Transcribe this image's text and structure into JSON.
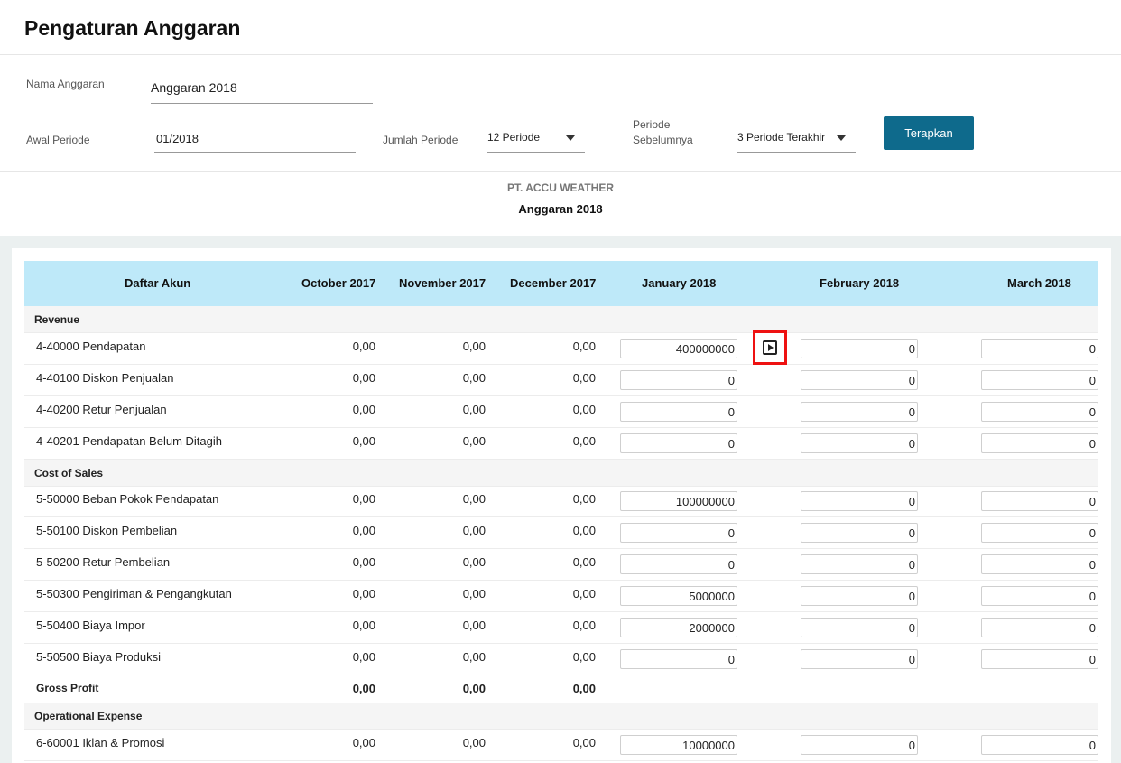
{
  "header": {
    "title": "Pengaturan Anggaran"
  },
  "form": {
    "name_label": "Nama Anggaran",
    "name_value": "Anggaran 2018",
    "start_label": "Awal Periode",
    "start_value": "01/2018",
    "count_label": "Jumlah Periode",
    "count_value": "12 Periode",
    "prev_label_line1": "Periode",
    "prev_label_line2": "Sebelumnya",
    "prev_value": "3 Periode Terakhir",
    "apply_label": "Terapkan"
  },
  "report": {
    "company": "PT. ACCU WEATHER",
    "title": "Anggaran 2018"
  },
  "table": {
    "headers": [
      "Daftar Akun",
      "October 2017",
      "November 2017",
      "December 2017",
      "January 2018",
      "February 2018",
      "March 2018"
    ],
    "sections": [
      {
        "label": "Revenue"
      },
      {
        "label": "Cost of Sales"
      },
      {
        "label": "Operational Expense"
      }
    ],
    "rows": [
      {
        "account": "4-40000 Pendapatan",
        "oct": "0,00",
        "nov": "0,00",
        "dec": "0,00",
        "jan": "400000000",
        "feb": "0",
        "mar": "0"
      },
      {
        "account": "4-40100 Diskon Penjualan",
        "oct": "0,00",
        "nov": "0,00",
        "dec": "0,00",
        "jan": "0",
        "feb": "0",
        "mar": "0"
      },
      {
        "account": "4-40200 Retur Penjualan",
        "oct": "0,00",
        "nov": "0,00",
        "dec": "0,00",
        "jan": "0",
        "feb": "0",
        "mar": "0"
      },
      {
        "account": "4-40201 Pendapatan Belum Ditagih",
        "oct": "0,00",
        "nov": "0,00",
        "dec": "0,00",
        "jan": "0",
        "feb": "0",
        "mar": "0"
      },
      {
        "account": "5-50000 Beban Pokok Pendapatan",
        "oct": "0,00",
        "nov": "0,00",
        "dec": "0,00",
        "jan": "100000000",
        "feb": "0",
        "mar": "0"
      },
      {
        "account": "5-50100 Diskon Pembelian",
        "oct": "0,00",
        "nov": "0,00",
        "dec": "0,00",
        "jan": "0",
        "feb": "0",
        "mar": "0"
      },
      {
        "account": "5-50200 Retur Pembelian",
        "oct": "0,00",
        "nov": "0,00",
        "dec": "0,00",
        "jan": "0",
        "feb": "0",
        "mar": "0"
      },
      {
        "account": "5-50300 Pengiriman & Pengangkutan",
        "oct": "0,00",
        "nov": "0,00",
        "dec": "0,00",
        "jan": "5000000",
        "feb": "0",
        "mar": "0"
      },
      {
        "account": "5-50400 Biaya Impor",
        "oct": "0,00",
        "nov": "0,00",
        "dec": "0,00",
        "jan": "2000000",
        "feb": "0",
        "mar": "0"
      },
      {
        "account": "5-50500 Biaya Produksi",
        "oct": "0,00",
        "nov": "0,00",
        "dec": "0,00",
        "jan": "0",
        "feb": "0",
        "mar": "0"
      },
      {
        "account": "6-60001 Iklan & Promosi",
        "oct": "0,00",
        "nov": "0,00",
        "dec": "0,00",
        "jan": "10000000",
        "feb": "0",
        "mar": "0"
      }
    ],
    "gross_profit": {
      "label": "Gross Profit",
      "oct": "0,00",
      "nov": "0,00",
      "dec": "0,00"
    }
  },
  "icons": {
    "copy_button": "play-square-icon"
  },
  "colors": {
    "accent": "#0e6a8c",
    "header_bg": "#bee9f9",
    "highlight": "#ee1111"
  }
}
